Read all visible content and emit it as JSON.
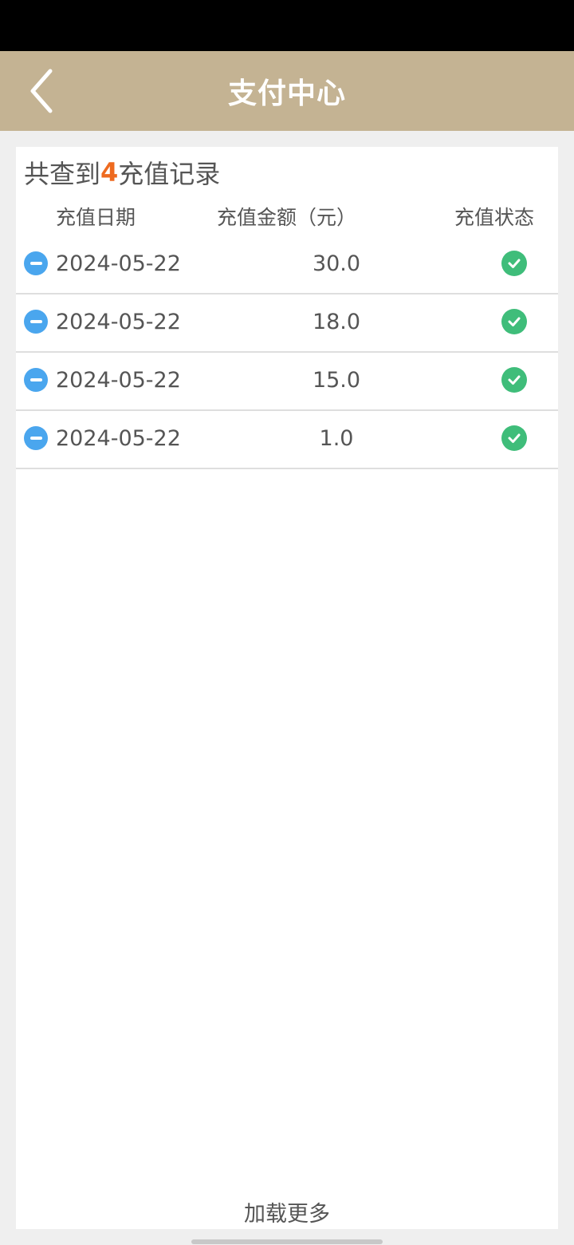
{
  "header": {
    "title": "支付中心",
    "back_icon": "chevron-left-icon"
  },
  "summary": {
    "prefix": "共查到",
    "count": "4",
    "suffix": "充值记录"
  },
  "columns": {
    "date": "充值日期",
    "amount": "充值金额（元）",
    "status": "充值状态"
  },
  "records": [
    {
      "date": "2024-05-22",
      "amount": "30.0",
      "status_icon": "check-circle-icon"
    },
    {
      "date": "2024-05-22",
      "amount": "18.0",
      "status_icon": "check-circle-icon"
    },
    {
      "date": "2024-05-22",
      "amount": "15.0",
      "status_icon": "check-circle-icon"
    },
    {
      "date": "2024-05-22",
      "amount": "1.0",
      "status_icon": "check-circle-icon"
    }
  ],
  "footer": {
    "load_more": "加载更多"
  },
  "colors": {
    "header_bg": "#c4b393",
    "count_accent": "#ee6a1f",
    "status_green": "#3fbd7a",
    "row_icon_blue": "#4aa6ee"
  }
}
